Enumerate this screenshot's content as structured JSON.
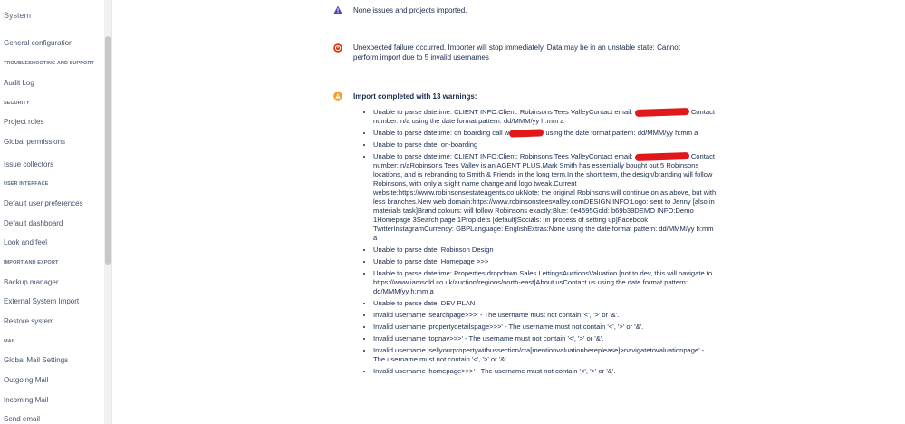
{
  "sidebar": {
    "system": "System",
    "items": [
      {
        "type": "link",
        "label": "General configuration"
      },
      {
        "type": "head",
        "label": "TROUBLESHOOTING AND SUPPORT"
      },
      {
        "type": "link",
        "label": "Audit Log"
      },
      {
        "type": "head",
        "label": "SECURITY"
      },
      {
        "type": "link",
        "label": "Project roles"
      },
      {
        "type": "link",
        "label": "Global permissions"
      },
      {
        "type": "link",
        "label": "Issue collectors"
      },
      {
        "type": "head",
        "label": "USER INTERFACE"
      },
      {
        "type": "link",
        "label": "Default user preferences"
      },
      {
        "type": "link",
        "label": "Default dashboard"
      },
      {
        "type": "link",
        "label": "Look and feel"
      },
      {
        "type": "head",
        "label": "IMPORT AND EXPORT"
      },
      {
        "type": "link",
        "label": "Backup manager"
      },
      {
        "type": "link",
        "label": "External System Import"
      },
      {
        "type": "link",
        "label": "Restore system"
      },
      {
        "type": "head",
        "label": "MAIL"
      },
      {
        "type": "link",
        "label": "Global Mail Settings"
      },
      {
        "type": "link",
        "label": "Outgoing Mail"
      },
      {
        "type": "link",
        "label": "Incoming Mail"
      },
      {
        "type": "link",
        "label": "Send email"
      }
    ]
  },
  "messages": {
    "info": "None issues and projects imported.",
    "error": "Unexpected failure occurred. Importer will stop immediately. Data may be in an unstable state: Cannot perform import due to 5 invalid usernames",
    "warning_title": "Import completed with 13 warnings:"
  },
  "warnings": [
    {
      "parts": [
        "Unable to parse datetime: CLIENT INFO:Client: Robinsons Tees ValleyContact email: ",
        "Contact number: n/a using the date format pattern: dd/MMM/yy h:mm a"
      ]
    },
    {
      "parts": [
        "Unable to parse datetime: on boarding call w",
        "using the date format pattern: dd/MMM/yy h:mm a"
      ]
    },
    {
      "parts": [
        "Unable to parse date: on-boarding"
      ]
    },
    {
      "parts": [
        "Unable to parse datetime: CLIENT INFO:Client: Robinsons Tees ValleyContact email: ",
        "Contact number: n/aRobinsons Tees Valley is an AGENT PLUS.Mark Smith has essentially bought out 5 Robinsons locations, and is rebranding to Smith & Friends in the long term.In the short term, the design/branding will follow Robinsons, with only a slight name change and logo tweak.Current website:https://www.robinsonsestateagents.co.ukNote: the original Robinsons will continue on as above, but with less branches.New web domain:https://www.robinsonsteesvalley.comDESIGN INFO:Logo: sent to Jenny [also in materials task]Brand colours: will follow Robinsons exactly:Blue: 0e4595Gold: b69b39DEMO INFO:Demo 1Homepage 3Search page 1Prop dets [default]Socials: [in process of setting up]Facebook TwitterInstagramCurrency: GBPLanguage: EnglishExtras:None using the date format pattern: dd/MMM/yy h:mm a"
      ]
    },
    {
      "parts": [
        "Unable to parse date: Robinson Design"
      ]
    },
    {
      "parts": [
        "Unable to parse date: Homepage >>>"
      ]
    },
    {
      "parts": [
        "Unable to parse datetime: Properties dropdown Sales LettingsAuctionsValuation [not to dev, this will navigate to https://www.iamsold.co.uk/auction/regions/north-east]About usContact us using the date format pattern: dd/MMM/yy h:mm a"
      ]
    },
    {
      "parts": [
        "Unable to parse date: DEV PLAN"
      ]
    },
    {
      "parts": [
        "Invalid username 'searchpage>>>' - The username must not contain '<', '>' or '&'."
      ]
    },
    {
      "parts": [
        "Invalid username 'propertydetailspage>>>' - The username must not contain '<', '>' or '&'."
      ]
    },
    {
      "parts": [
        "Invalid username 'topnav>>>' - The username must not contain '<', '>' or '&'."
      ]
    },
    {
      "parts": [
        "Invalid username 'sellyourpropertywithussection/cta[mentionvaluationhereplease]>navigatetovaluationpage' - The username must not contain '<', '>' or '&'."
      ]
    },
    {
      "parts": [
        "Invalid username 'homepage>>>' - The username must not contain '<', '>' or '&'."
      ]
    }
  ],
  "colors": {
    "info": "#5243aa",
    "error": "#de350b",
    "warning": "#ff991f",
    "redaction": "#e0181b"
  }
}
